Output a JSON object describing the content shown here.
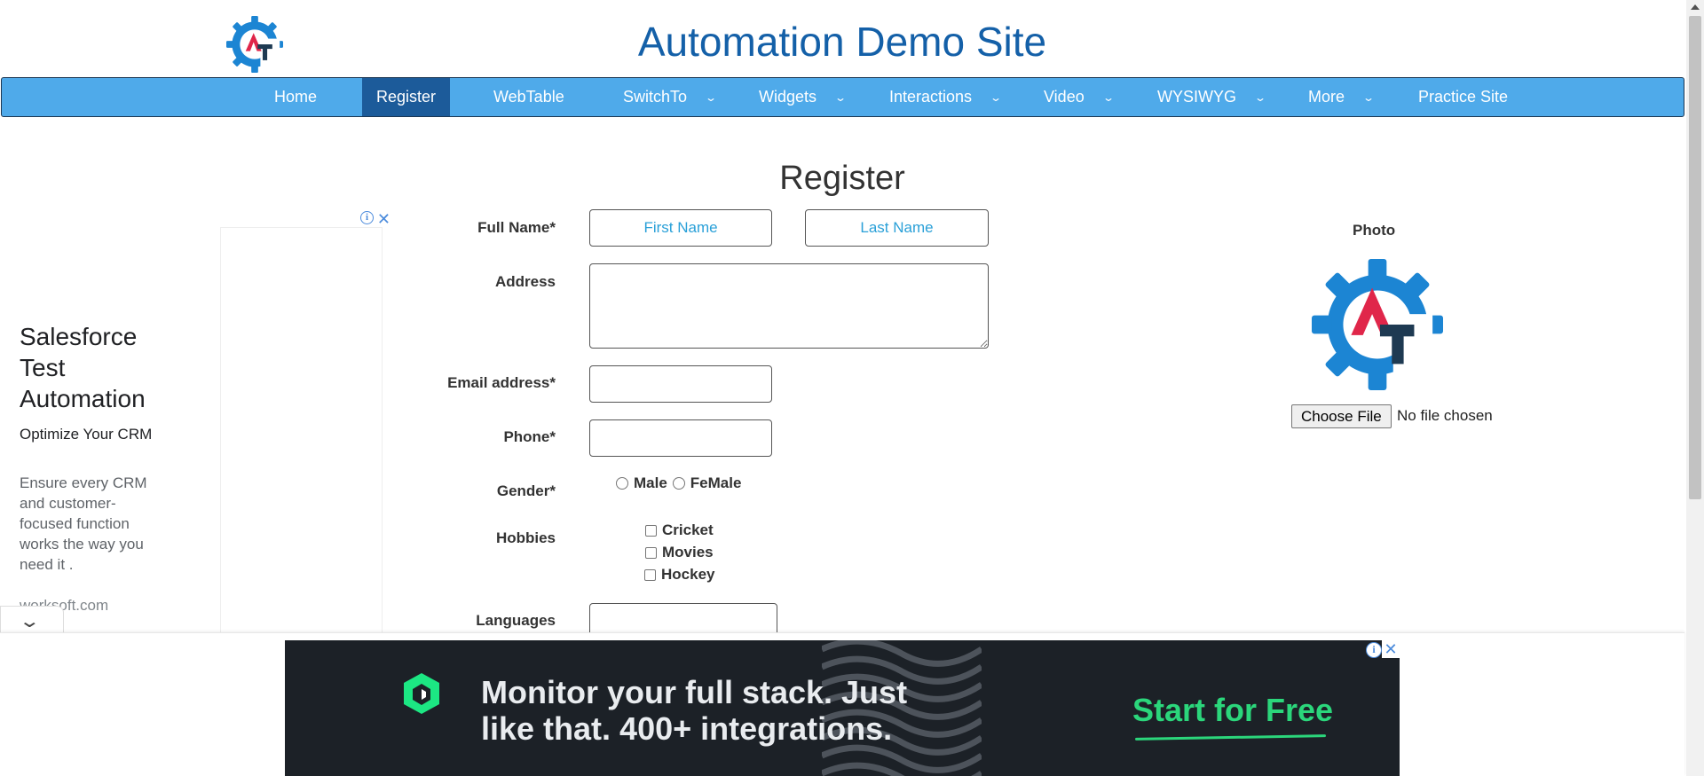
{
  "header": {
    "title": "Automation Demo Site",
    "logo_letters": "AT"
  },
  "nav": {
    "items": [
      {
        "label": "Home",
        "dropdown": false,
        "active": false
      },
      {
        "label": "Register",
        "dropdown": false,
        "active": true
      },
      {
        "label": "WebTable",
        "dropdown": false,
        "active": false
      },
      {
        "label": "SwitchTo",
        "dropdown": true,
        "active": false
      },
      {
        "label": "Widgets",
        "dropdown": true,
        "active": false
      },
      {
        "label": "Interactions",
        "dropdown": true,
        "active": false
      },
      {
        "label": "Video",
        "dropdown": true,
        "active": false
      },
      {
        "label": "WYSIWYG",
        "dropdown": true,
        "active": false
      },
      {
        "label": "More",
        "dropdown": true,
        "active": false
      },
      {
        "label": "Practice Site",
        "dropdown": false,
        "active": false
      }
    ],
    "dropdown_icon": "chevron-down-icon",
    "bar_color": "#4faaea",
    "active_color": "#1c5b9a"
  },
  "page": {
    "title": "Register"
  },
  "form": {
    "full_name_label": "Full Name*",
    "first_name_placeholder": "First Name",
    "last_name_placeholder": "Last Name",
    "first_name_value": "",
    "last_name_value": "",
    "address_label": "Address",
    "address_value": "",
    "email_label": "Email address*",
    "email_value": "",
    "phone_label": "Phone*",
    "phone_value": "",
    "gender_label": "Gender*",
    "gender_options": [
      "Male",
      "FeMale"
    ],
    "hobbies_label": "Hobbies",
    "hobbies_options": [
      "Cricket",
      "Movies",
      "Hockey"
    ],
    "languages_label": "Languages",
    "languages_value": ""
  },
  "photo": {
    "label": "Photo",
    "choose_button": "Choose File",
    "no_file_text": "No file chosen"
  },
  "side_ad": {
    "headline": "Salesforce Test Automation",
    "subheadline": "Optimize Your CRM",
    "body": "Ensure every CRM and customer-focused function works the way you need it .",
    "domain": "worksoft.com",
    "close_icon": "close-icon",
    "info_icon": "info-icon"
  },
  "bottom_ad": {
    "text": "Monitor your full stack. Just like that. 400+ integrations.",
    "cta": "Start for Free",
    "cta_color": "#2bd67b",
    "background": "#1c2127"
  },
  "brand_colors": {
    "title_blue": "#1460a8",
    "logo_red": "#e0264a",
    "logo_navy": "#1e3a52",
    "logo_gear": "#1c85d3"
  }
}
